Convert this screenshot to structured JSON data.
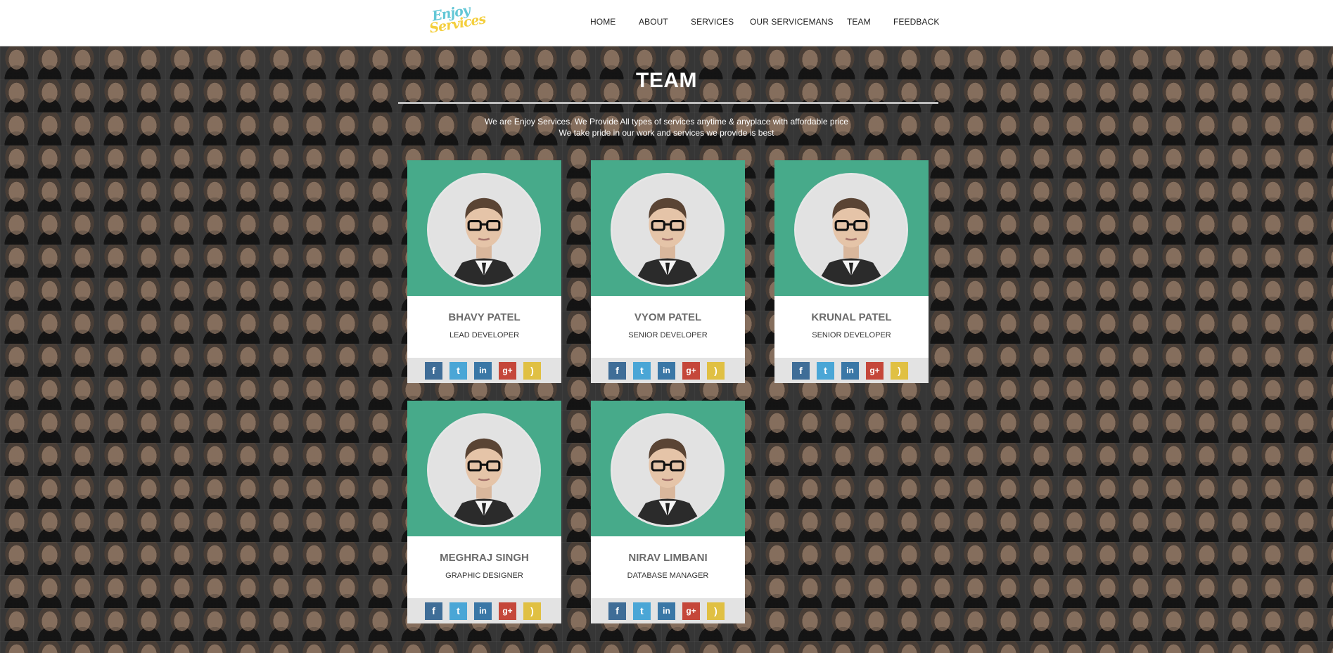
{
  "header": {
    "logo": {
      "line1": "Enjoy",
      "line2": "Services"
    },
    "nav": [
      "HOME",
      "ABOUT",
      "SERVICES",
      "OUR SERVICEMANS",
      "TEAM",
      "FEEDBACK"
    ]
  },
  "team": {
    "title": "TEAM",
    "intro_line1": "We are Enjoy Services. We Provide All types of services anytime & anyplace with affordable price",
    "intro_line2": "We take pride in our work and services we provide is best",
    "members": [
      {
        "name": "BHAVY PATEL",
        "role": "LEAD DEVELOPER"
      },
      {
        "name": "VYOM PATEL",
        "role": "SENIOR DEVELOPER"
      },
      {
        "name": "KRUNAL PATEL",
        "role": "SENIOR DEVELOPER"
      },
      {
        "name": "MEGHRAJ SINGH",
        "role": "GRAPHIC DESIGNER"
      },
      {
        "name": "NIRAV LIMBANI",
        "role": "DATABASE MANAGER"
      }
    ],
    "social_icons": [
      "facebook-icon",
      "twitter-icon",
      "linkedin-icon",
      "google-plus-icon",
      "rss-icon"
    ],
    "social_glyphs": [
      "f",
      "t",
      "in",
      "g+",
      ")"
    ]
  },
  "colors": {
    "card_header": "#2e9e7a",
    "logo_cyan": "#63c7d6",
    "logo_yellow": "#f4cf3e",
    "facebook": "#3f6d97",
    "twitter": "#4aa6d6",
    "linkedin": "#3a77a6",
    "google_plus": "#c5473a",
    "rss": "#e0c043"
  }
}
